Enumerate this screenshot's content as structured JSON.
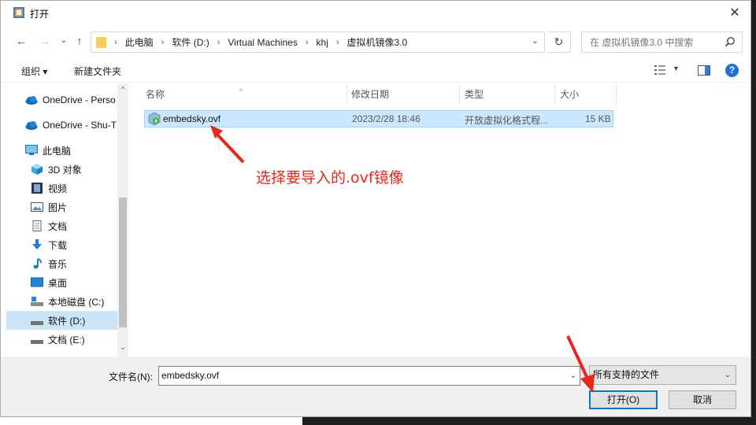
{
  "window": {
    "title": "打开",
    "close_glyph": "✕"
  },
  "nav": {
    "back_glyph": "←",
    "forward_glyph": "→",
    "recent_glyph": "⌄",
    "up_glyph": "↑",
    "breadcrumbs": [
      "此电脑",
      "软件 (D:)",
      "Virtual Machines",
      "khj",
      "虚拟机镜像3.0"
    ],
    "separator": "›",
    "dropdown_glyph": "⌄",
    "refresh_glyph": "↻",
    "search_placeholder": "在 虚拟机镜像3.0 中搜索"
  },
  "toolbar": {
    "organize_label": "组织 ▾",
    "new_folder_label": "新建文件夹",
    "view_glyph": "▾",
    "help_glyph": "?"
  },
  "sidebar": {
    "items": [
      {
        "label": "OneDrive - Perso",
        "icon": "cloud-icon"
      },
      {
        "label": "OneDrive - Shu-T",
        "icon": "cloud-icon"
      },
      {
        "label": "此电脑",
        "icon": "computer-icon"
      },
      {
        "label": "3D 对象",
        "icon": "cube-icon"
      },
      {
        "label": "视频",
        "icon": "video-icon"
      },
      {
        "label": "图片",
        "icon": "picture-icon"
      },
      {
        "label": "文档",
        "icon": "document-icon"
      },
      {
        "label": "下载",
        "icon": "download-icon"
      },
      {
        "label": "音乐",
        "icon": "music-icon"
      },
      {
        "label": "桌面",
        "icon": "desktop-icon"
      },
      {
        "label": "本地磁盘 (C:)",
        "icon": "drive-icon"
      },
      {
        "label": "软件 (D:)",
        "icon": "drive-icon"
      },
      {
        "label": "文档 (E:)",
        "icon": "drive-icon"
      }
    ],
    "selected_index": 11,
    "scroll_up_glyph": "^",
    "scroll_down_glyph": "⌄"
  },
  "filelist": {
    "columns": [
      "名称",
      "修改日期",
      "类型",
      "大小"
    ],
    "sort_glyph": "^",
    "rows": [
      {
        "name": "embedsky.ovf",
        "date": "2023/2/28 18:46",
        "type": "开放虚拟化格式程...",
        "size": "15 KB"
      }
    ]
  },
  "annotation": {
    "text": "选择要导入的.ovf镜像",
    "color": "#e8261a"
  },
  "bottom": {
    "filename_label": "文件名(N):",
    "filename_value": "embedsky.ovf",
    "filetype_value": "所有支持的文件",
    "open_label": "打开(O)",
    "cancel_label": "取消",
    "dropdown_glyph": "⌄"
  },
  "colors": {
    "accent": "#0078d7",
    "selection": "#cce8ff",
    "help": "#1e6fd9"
  }
}
